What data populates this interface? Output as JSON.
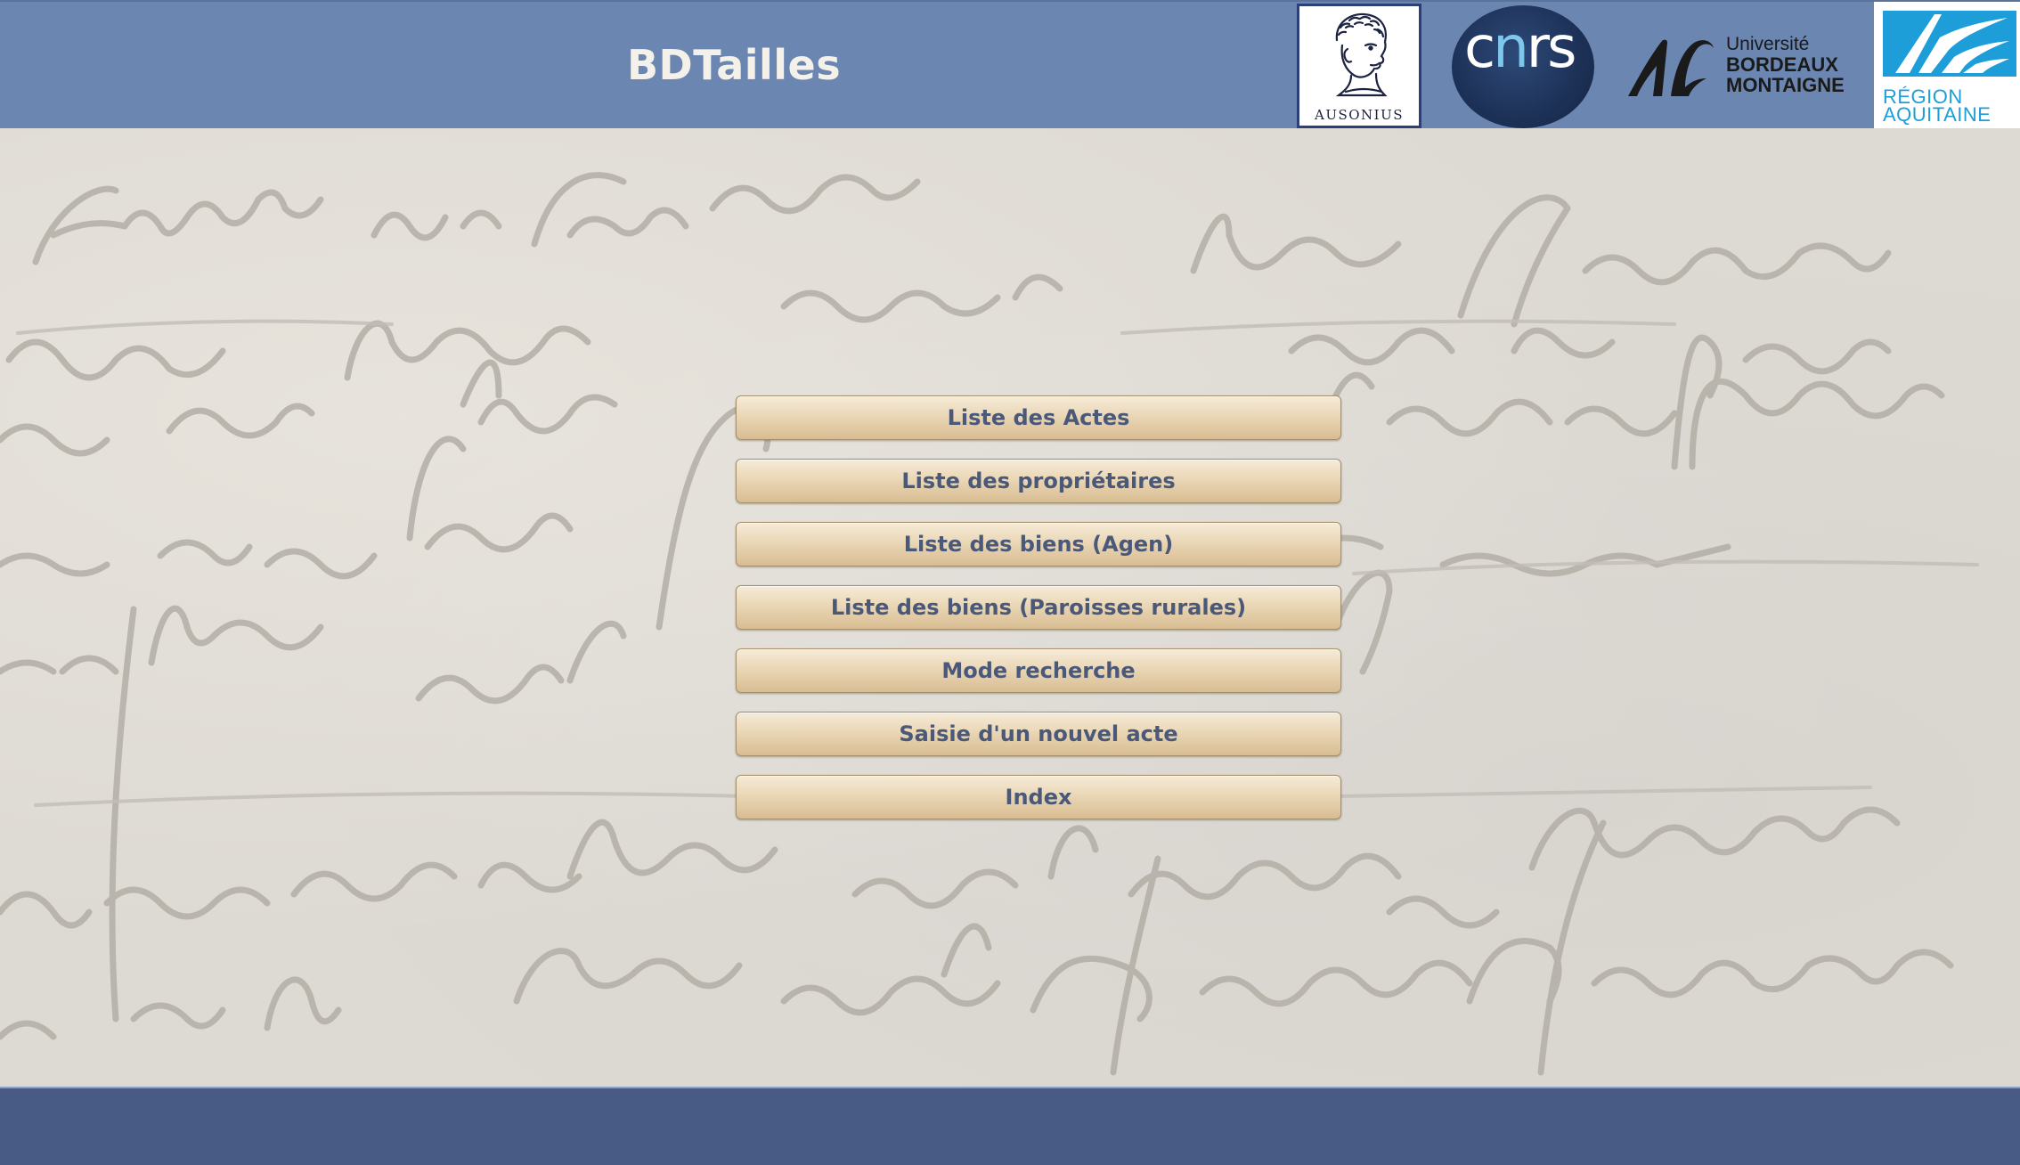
{
  "header": {
    "title": "BDTailles",
    "colors": {
      "bar": "#6b86b0",
      "title": "#f4f1ea"
    }
  },
  "logos": {
    "ausonius": {
      "caption": "AUSONIUS",
      "icon": "ausonius-head-logo"
    },
    "cnrs": {
      "word_white_1": "c",
      "word_blue": "n",
      "word_white_2": "rs",
      "icon": "cnrs-logo"
    },
    "ubm": {
      "line1": "Université",
      "line2": "BORDEAUX",
      "line3": "MONTAIGNE",
      "icon": "ubm-logo"
    },
    "region": {
      "line1": "RÉGION",
      "line2": "AQUITAINE",
      "icon": "region-aquitaine-logo",
      "color": "#1d9ed9"
    }
  },
  "menu": {
    "items": [
      {
        "label": "Liste des Actes"
      },
      {
        "label": "Liste des propriétaires"
      },
      {
        "label": "Liste des biens (Agen)"
      },
      {
        "label": "Liste des biens (Paroisses rurales)"
      },
      {
        "label": "Mode recherche"
      },
      {
        "label": "Saisie d'un nouvel acte"
      },
      {
        "label": "Index"
      }
    ],
    "colors": {
      "text": "#4a5879",
      "button_top": "#f6ebd8",
      "button_bottom": "#d8bd92"
    }
  },
  "footer": {
    "color": "#475b84"
  }
}
